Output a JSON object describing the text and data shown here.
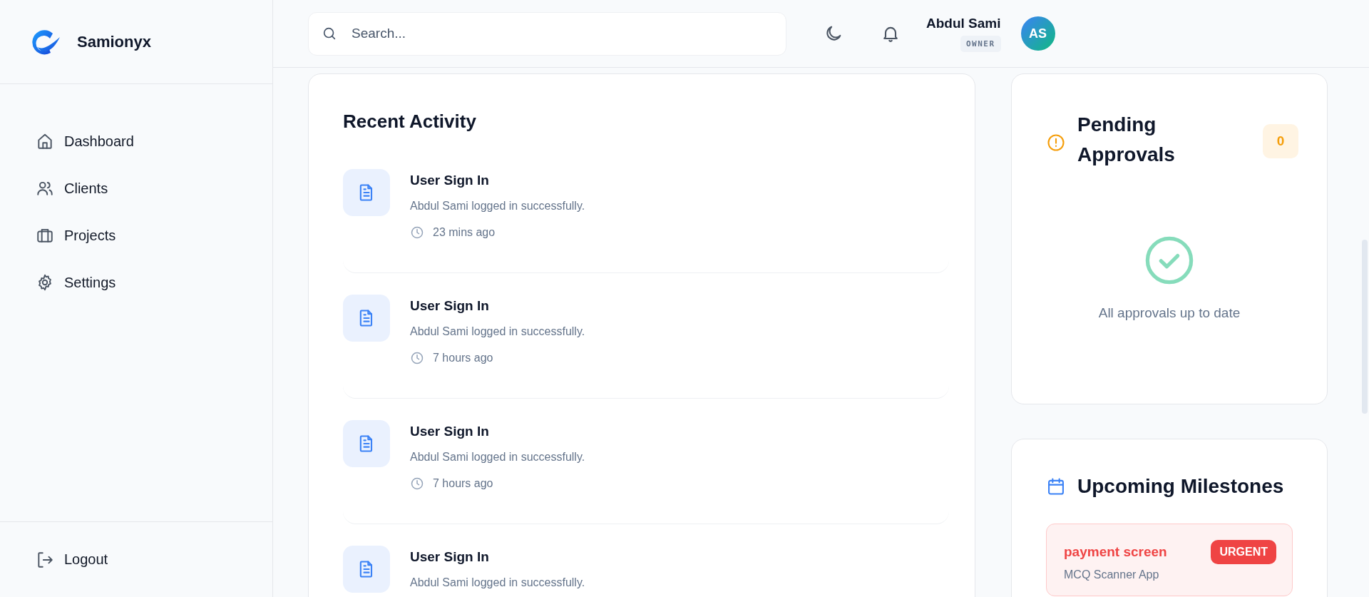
{
  "sidebar": {
    "brand": "Samionyx",
    "items": [
      {
        "label": "Dashboard",
        "selected": false
      },
      {
        "label": "Clients",
        "selected": false
      },
      {
        "label": "Projects",
        "selected": false
      },
      {
        "label": "Settings",
        "selected": false
      }
    ],
    "logout": "Logout"
  },
  "header": {
    "search": {
      "placeholder": "Search..."
    },
    "user": {
      "name": "Abdul Sami",
      "role": "OWNER",
      "initials": "AS"
    }
  },
  "recent_activity": {
    "title": "Recent Activity",
    "items": [
      {
        "title": "User Sign In",
        "description": "Abdul Sami logged in successfully.",
        "time": "23 mins ago"
      },
      {
        "title": "User Sign In",
        "description": "Abdul Sami logged in successfully.",
        "time": "7 hours ago"
      },
      {
        "title": "User Sign In",
        "description": "Abdul Sami logged in successfully.",
        "time": "7 hours ago"
      },
      {
        "title": "User Sign In",
        "description": "Abdul Sami logged in successfully."
      }
    ]
  },
  "pending_approvals": {
    "title": "Pending Approvals",
    "count": "0",
    "empty_message": "All approvals up to date"
  },
  "upcoming_milestones": {
    "title": "Upcoming Milestones",
    "items": [
      {
        "title": "payment screen",
        "project": "MCQ Scanner App",
        "priority": "URGENT",
        "kind": "urgent"
      }
    ]
  }
}
